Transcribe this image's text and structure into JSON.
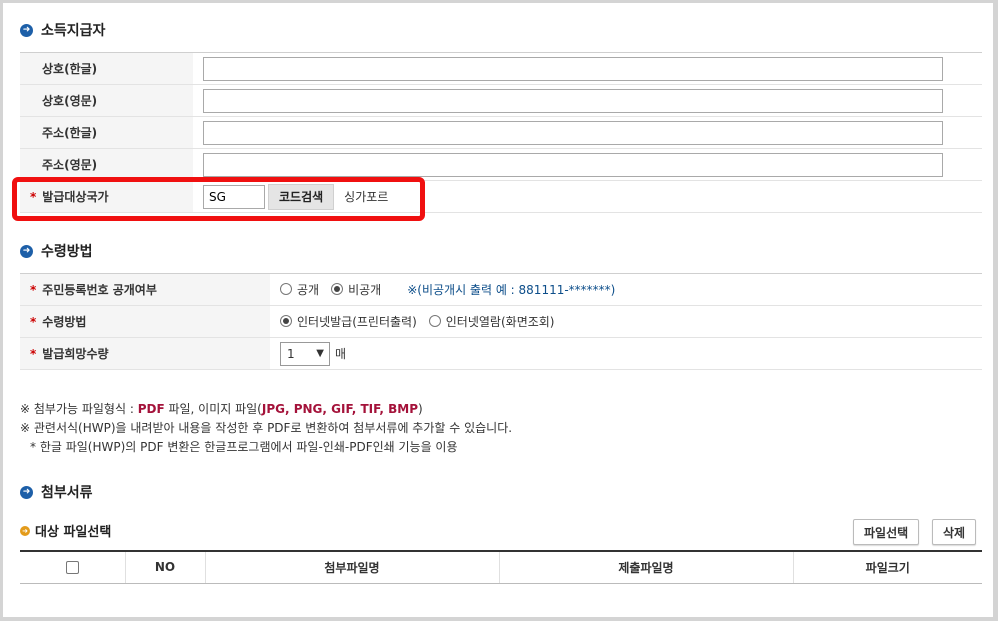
{
  "issuer": {
    "title": "소득지급자",
    "fields": [
      {
        "label": "상호(한글)",
        "value": ""
      },
      {
        "label": "상호(영문)",
        "value": ""
      },
      {
        "label": "주소(한글)",
        "value": ""
      },
      {
        "label": "주소(영문)",
        "value": ""
      }
    ],
    "country": {
      "label": "발급대상국가",
      "required_mark": "*",
      "code_value": "SG",
      "search_button": "코드검색",
      "country_name": "싱가포르"
    }
  },
  "receipt": {
    "title": "수령방법",
    "disclosure": {
      "label": "주민등록번호 공개여부",
      "option_public": "공개",
      "option_private": "비공개",
      "selected": "비공개",
      "note": "※(비공개시 출력 예 : 881111-*******)"
    },
    "method": {
      "label": "수령방법",
      "option_print": "인터넷발급(프린터출력)",
      "option_view": "인터넷열람(화면조회)",
      "selected": "인터넷발급(프린터출력)"
    },
    "quantity": {
      "label": "발급희망수량",
      "selected": "1",
      "unit": "매"
    }
  },
  "notes": {
    "line1_prefix": "※ 첨부가능 파일형식 : ",
    "line1_pdf": "PDF",
    "line1_mid": " 파일, 이미지 파일(",
    "line1_formats": "JPG, PNG, GIF, TIF, BMP",
    "line1_suffix": ")",
    "line2": "※ 관련서식(HWP)을 내려받아 내용을 작성한 후 PDF로 변환하여 첨부서류에 추가할 수 있습니다.",
    "line3": "* 한글 파일(HWP)의 PDF 변환은 한글프로그램에서 파일-인쇄-PDF인쇄 기능을 이용"
  },
  "attachments": {
    "title": "첨부서류",
    "subtitle": "대상 파일선택",
    "select_button": "파일선택",
    "delete_button": "삭제",
    "columns": [
      "NO",
      "첨부파일명",
      "제출파일명",
      "파일크기"
    ]
  },
  "colors": {
    "highlight": "#f01010",
    "section_bullet": "#1d5fa8",
    "sub_bullet": "#e39b1b",
    "required": "#cc0000",
    "note_blue": "#0d4e8a",
    "format_red": "#a4123a"
  }
}
